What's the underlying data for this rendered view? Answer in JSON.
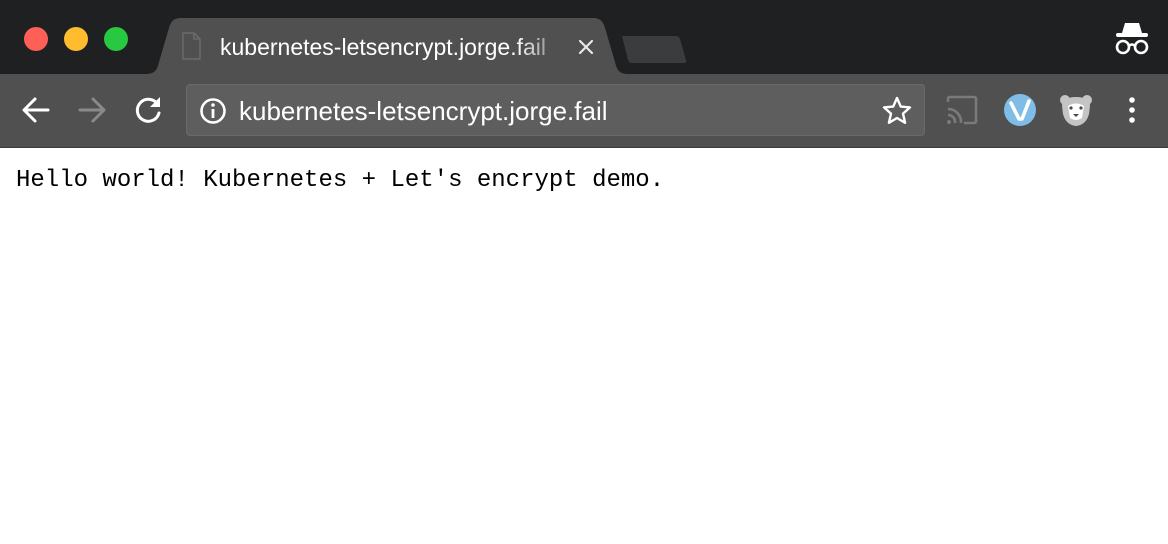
{
  "browser": {
    "tab": {
      "title": "kubernetes-letsencrypt.jorge.fail",
      "favicon": "page-icon"
    },
    "toolbar": {
      "back": "back-arrow-icon",
      "forward": "forward-arrow-icon",
      "reload": "reload-icon",
      "url": "kubernetes-letsencrypt.jorge.fail",
      "site_info": "info-icon",
      "bookmark": "star-icon",
      "extensions": [
        "cast-icon",
        "vimium-icon",
        "privacy-badger-icon"
      ],
      "menu": "kebab-menu-icon"
    },
    "incognito": "incognito-icon",
    "colors": {
      "tabstrip": "#1f2022",
      "toolbar": "#505050",
      "omnibox": "#5e5e5e",
      "close": "#fe5f57",
      "minimize": "#febc2e",
      "zoom": "#28c840",
      "vimium": "#7fbde7"
    }
  },
  "page": {
    "body_text": "Hello world! Kubernetes + Let's encrypt demo."
  }
}
